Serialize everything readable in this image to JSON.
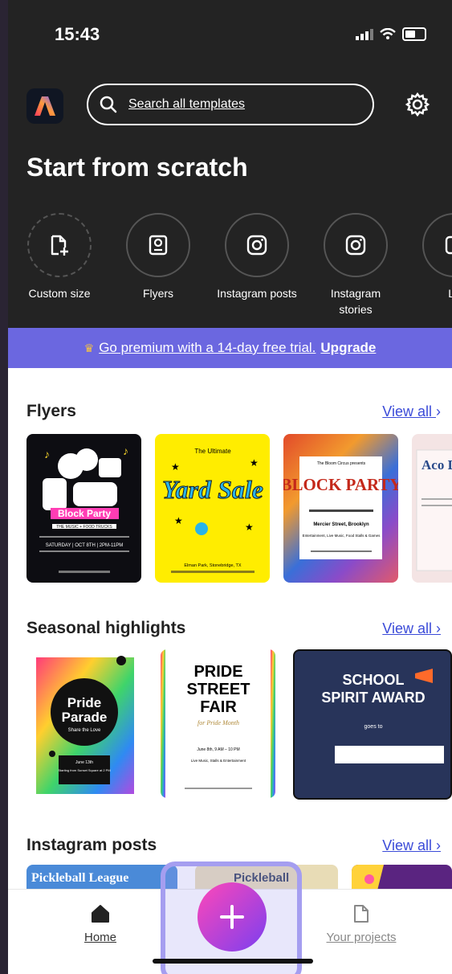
{
  "status_bar": {
    "time": "15:43"
  },
  "search": {
    "placeholder": "Search all templates"
  },
  "start": {
    "title": "Start from scratch",
    "actions": [
      {
        "label": "Custom size",
        "icon": "add-file-icon"
      },
      {
        "label": "Flyers",
        "icon": "flyer-icon"
      },
      {
        "label": "Instagram posts",
        "icon": "instagram-icon"
      },
      {
        "label": "Instagram stories",
        "icon": "instagram-icon"
      },
      {
        "label": "Lo",
        "icon": "logo-icon"
      }
    ]
  },
  "promo": {
    "text": "Go premium with a 14-day free trial.",
    "upgrade": "Upgrade"
  },
  "sections": {
    "flyers": {
      "title": "Flyers",
      "view_all": "View all",
      "cards": [
        {
          "heading": "Block Party",
          "line1": "THE MUSIC + FOOD TRUCKS",
          "line2": "SATURDAY | OCT 8TH | 2PM-11PM"
        },
        {
          "heading": "Yard Sale",
          "top": "The Ultimate",
          "bottom": "Elman Park, Stonebridge, TX"
        },
        {
          "heading": "BLOCK PARTY",
          "top": "The Bloom Circus presents",
          "line1": "Mercier Street, Brooklyn",
          "line2": "Entertainment, Live Music, Food Stalls & Games"
        },
        {
          "heading": "Aco Daz"
        }
      ]
    },
    "seasonal": {
      "title": "Seasonal highlights",
      "view_all": "View all",
      "cards": [
        {
          "heading": "Pride Parade",
          "sub": "Share the Love",
          "line1": "June 13th",
          "line2": "Starting from Sunset Square at 2 PM"
        },
        {
          "heading": "PRIDE STREET FAIR",
          "sub": "for Pride Month",
          "line1": "June 8th, 9 AM – 10 PM",
          "line2": "Live Music, Stalls & Entertainment"
        },
        {
          "heading": "SCHOOL SPIRIT AWARD",
          "sub": "goes to"
        }
      ]
    },
    "instagram": {
      "title": "Instagram posts",
      "view_all": "View all",
      "cards": [
        {
          "heading": "Pickleball League"
        },
        {
          "heading": "Pickleball"
        },
        {
          "heading": ""
        }
      ]
    }
  },
  "nav": {
    "home": "Home",
    "projects": "Your projects"
  },
  "colors": {
    "dark": "#232323",
    "promo": "#6b67e0",
    "link": "#3b4bd8",
    "fab_start": "#ff47b8",
    "fab_end": "#7b3ff0",
    "highlight": "#a59ef0"
  }
}
